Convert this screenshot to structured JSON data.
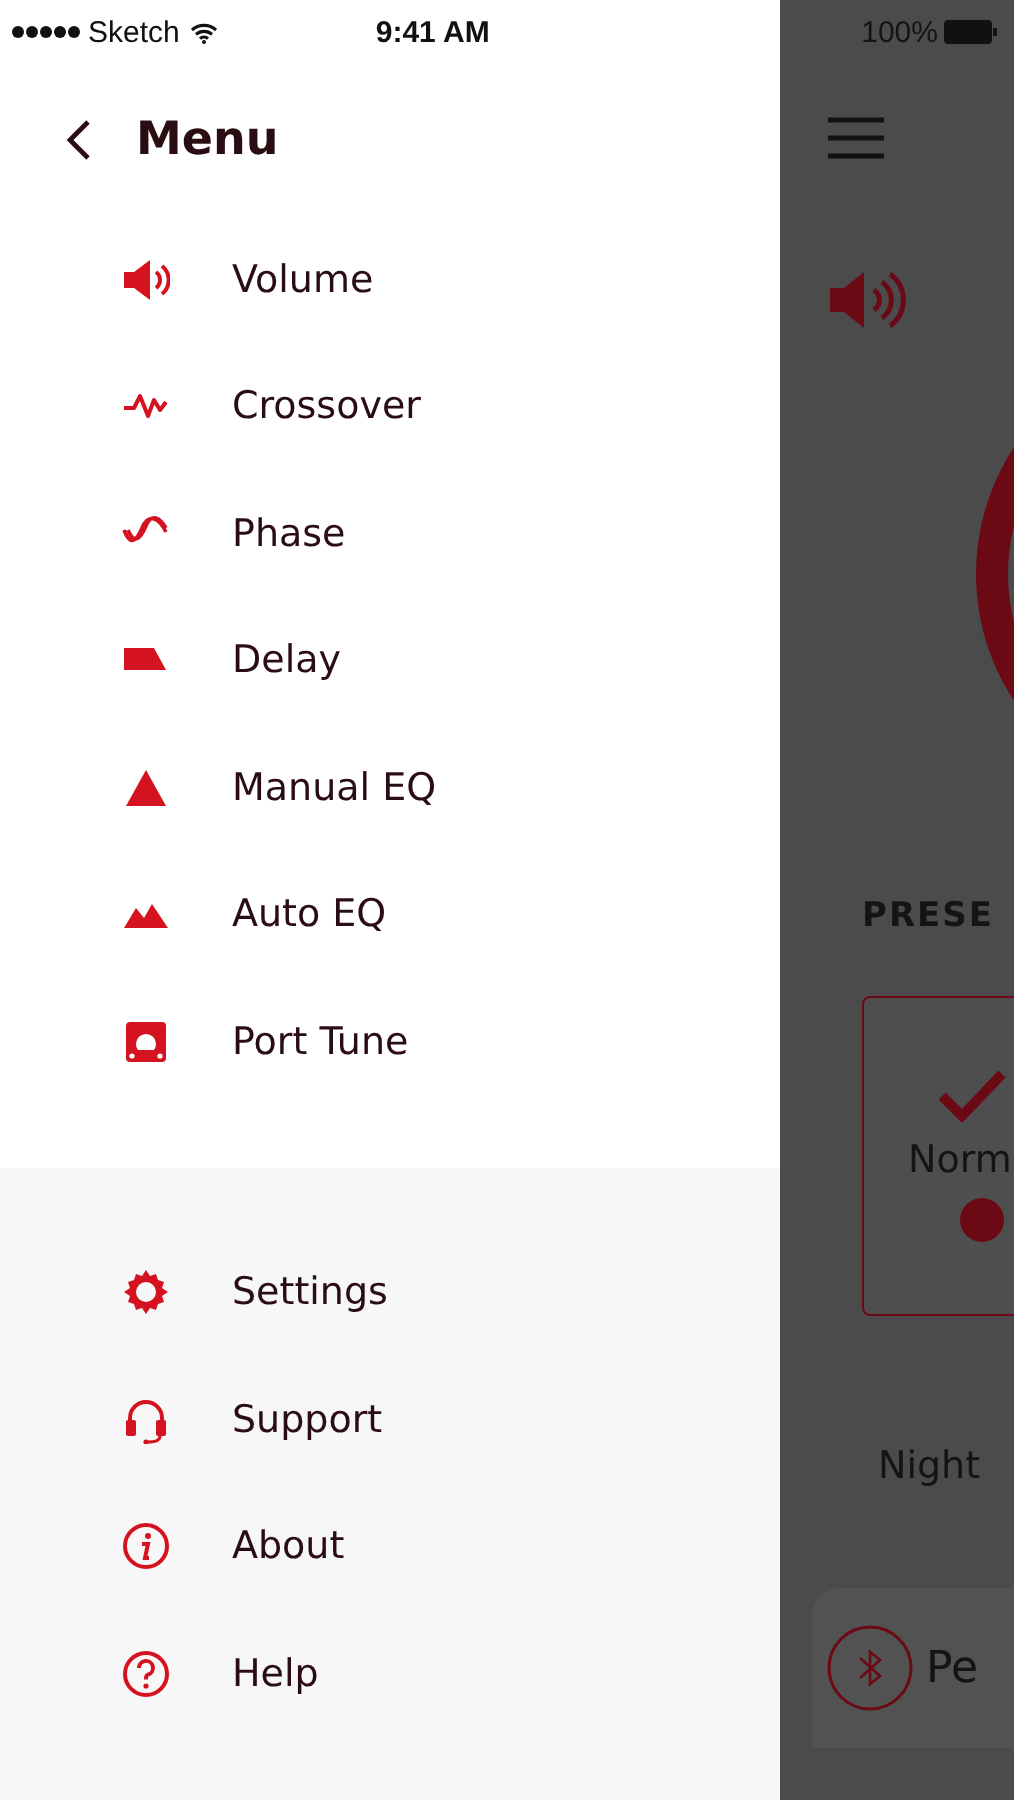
{
  "status_bar": {
    "carrier": "Sketch",
    "time": "9:41 AM",
    "battery": "100%"
  },
  "header": {
    "title": "Menu"
  },
  "menu": {
    "items": [
      {
        "label": "Volume",
        "kind": "speaker"
      },
      {
        "label": "Crossover",
        "kind": "zigzag"
      },
      {
        "label": "Phase",
        "kind": "wave"
      },
      {
        "label": "Delay",
        "kind": "slope"
      },
      {
        "label": "Manual EQ",
        "kind": "peak"
      },
      {
        "label": "Auto EQ",
        "kind": "peaks"
      },
      {
        "label": "Port Tune",
        "kind": "port"
      }
    ]
  },
  "footer_menu": {
    "items": [
      {
        "label": "Settings",
        "kind": "gear"
      },
      {
        "label": "Support",
        "kind": "headset"
      },
      {
        "label": "About",
        "kind": "info"
      },
      {
        "label": "Help",
        "kind": "help"
      }
    ]
  },
  "background_app": {
    "presets_heading": "PRESE",
    "presets": [
      {
        "label": "Norm",
        "selected": true
      },
      {
        "label": "Night",
        "selected": false
      }
    ],
    "bottom_bar": {
      "label": "Pe"
    }
  }
}
